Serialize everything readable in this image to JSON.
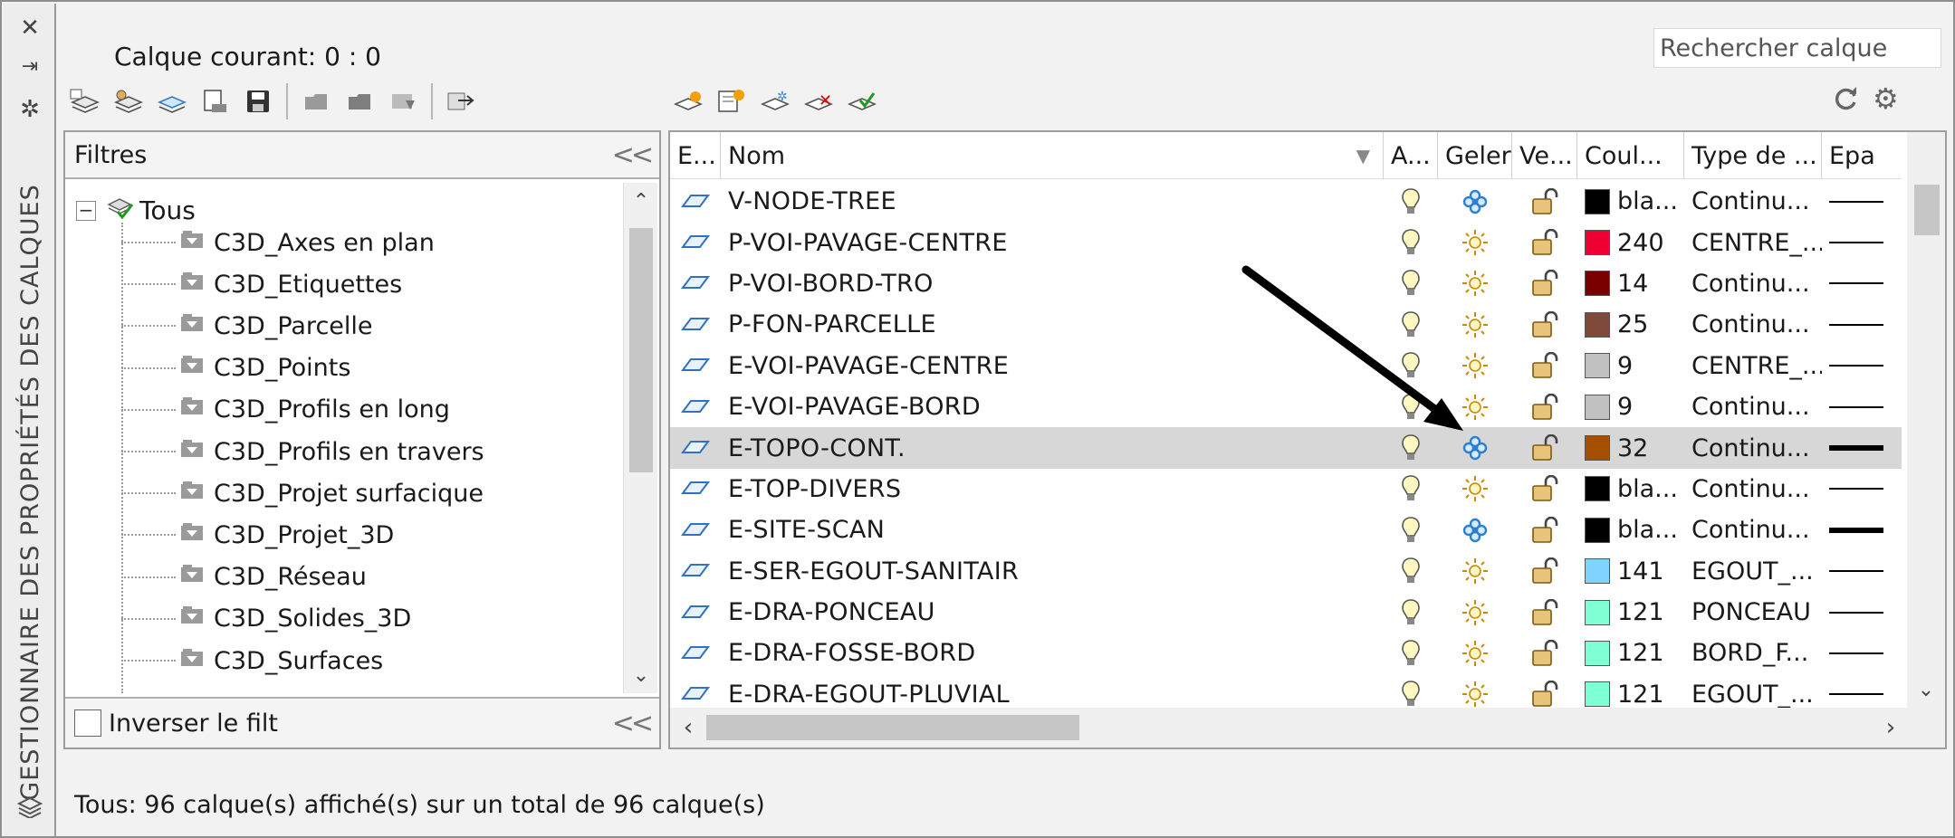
{
  "side": {
    "title": "GESTIONNAIRE DES PROPRIÉTÉS DES CALQUES",
    "icons": [
      "close-icon",
      "pin-icon",
      "settings-icon",
      "layers-icon"
    ]
  },
  "header": {
    "current_layer": "Calque courant: 0 : 0",
    "search_placeholder": "Rechercher calque"
  },
  "filters": {
    "title": "Filtres",
    "root": "Tous",
    "items": [
      "C3D_Axes en plan",
      "C3D_Etiquettes",
      "C3D_Parcelle",
      "C3D_Points",
      "C3D_Profils en long",
      "C3D_Profils en travers",
      "C3D_Projet surfacique",
      "C3D_Projet_3D",
      "C3D_Réseau",
      "C3D_Solides_3D",
      "C3D_Surfaces"
    ],
    "invert_label": "Inverser  le filt"
  },
  "grid": {
    "headers": {
      "e": "E...",
      "name": "Nom",
      "a": "A...",
      "freeze": "Geler",
      "lock": "Ve...",
      "color": "Coul...",
      "type": "Type de ...",
      "ep": "Epa"
    },
    "rows": [
      {
        "name": "V-NODE-TREE",
        "frozen": true,
        "color_hex": "#000000",
        "color": "bla...",
        "type": "Continu...",
        "thick": false
      },
      {
        "name": "P-VOI-PAVAGE-CENTRE",
        "frozen": false,
        "color_hex": "#ee0033",
        "color": "240",
        "type": "CENTRE_...",
        "thick": false
      },
      {
        "name": "P-VOI-BORD-TRO",
        "frozen": false,
        "color_hex": "#7a0000",
        "color": "14",
        "type": "Continu...",
        "thick": false
      },
      {
        "name": "P-FON-PARCELLE",
        "frozen": false,
        "color_hex": "#7f4a3a",
        "color": "25",
        "type": "Continu...",
        "thick": false
      },
      {
        "name": "E-VOI-PAVAGE-CENTRE",
        "frozen": false,
        "color_hex": "#c0c0c0",
        "color": "9",
        "type": "CENTRE_...",
        "thick": false
      },
      {
        "name": "E-VOI-PAVAGE-BORD",
        "frozen": false,
        "color_hex": "#c0c0c0",
        "color": "9",
        "type": "Continu...",
        "thick": false
      },
      {
        "name": "E-TOPO-CONT.",
        "frozen": true,
        "color_hex": "#a54f00",
        "color": "32",
        "type": "Continu...",
        "thick": true,
        "selected": true
      },
      {
        "name": "E-TOP-DIVERS",
        "frozen": false,
        "color_hex": "#000000",
        "color": "bla...",
        "type": "Continu...",
        "thick": false
      },
      {
        "name": "E-SITE-SCAN",
        "frozen": true,
        "color_hex": "#000000",
        "color": "bla...",
        "type": "Continu...",
        "thick": true
      },
      {
        "name": "E-SER-EGOUT-SANITAIR",
        "frozen": false,
        "color_hex": "#7fd4ff",
        "color": "141",
        "type": "EGOUT_...",
        "thick": false
      },
      {
        "name": "E-DRA-PONCEAU",
        "frozen": false,
        "color_hex": "#7fffd4",
        "color": "121",
        "type": "PONCEAU",
        "thick": false
      },
      {
        "name": "E-DRA-FOSSE-BORD",
        "frozen": false,
        "color_hex": "#7fffd4",
        "color": "121",
        "type": "BORD_F...",
        "thick": false
      },
      {
        "name": "E-DRA-EGOUT-PLUVIAL",
        "frozen": false,
        "color_hex": "#7fffd4",
        "color": "121",
        "type": "EGOUT_...",
        "thick": false
      }
    ]
  },
  "status": "Tous: 96 calque(s) affiché(s) sur un total de 96 calque(s)"
}
